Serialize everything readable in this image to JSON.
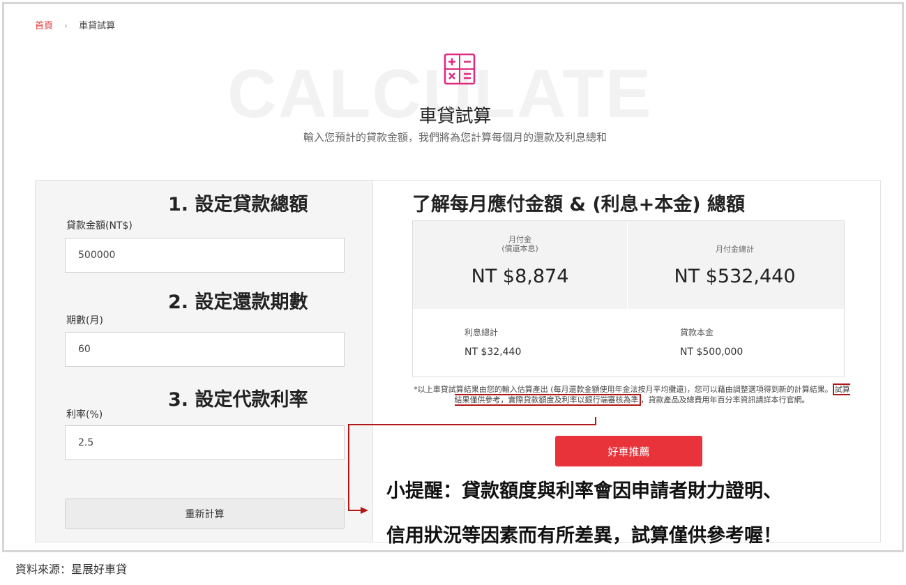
{
  "breadcrumb": {
    "home": "首頁",
    "separator": "›",
    "current": "車貸試算"
  },
  "hero": {
    "bg_word": "CALCULATE",
    "title": "車貸試算",
    "subtitle": "輸入您預計的貸款金額，我們將為您計算每個月的還款及利息總和"
  },
  "steps": {
    "step1": "1. 設定貸款總額",
    "step2": "2. 設定還款期數",
    "step3": "3. 設定代款利率",
    "right_heading": "了解每月應付金額 & (利息+本金) 總額"
  },
  "form": {
    "amount_label": "貸款金額(NT$)",
    "amount_value": "500000",
    "period_label": "期數(月)",
    "period_value": "60",
    "rate_label": "利率(%)",
    "rate_value": "2.5",
    "recalc_label": "重新計算"
  },
  "results": {
    "monthly_label": "月付金",
    "monthly_sub": "(償還本息)",
    "monthly_value": "NT $8,874",
    "total_label": "月付金總計",
    "total_value": "NT $532,440",
    "interest_label": "利息總計",
    "interest_value": "NT $32,440",
    "principal_label": "貸款本金",
    "principal_value": "NT $500,000"
  },
  "note": {
    "part1": "*以上車貸試算結果由您的輸入估算產出 (每月還款金額使用年金法按月平均攤還)，您可以藉由調整選項得到新的計算結果。",
    "highlight": "試算結果僅供參考，實際貸款額度及利率以銀行端審核為準",
    "part2": "，貸款產品及總費用年百分率資訊請詳本行官網。"
  },
  "car_button": "好車推薦",
  "reminder": {
    "line1": "小提醒：貸款額度與利率會因申請者財力證明、",
    "line2": "信用狀況等因素而有所差異，試算僅供參考喔！"
  },
  "source": "資料來源：星展好車貸",
  "colors": {
    "accent_red": "#e8333b",
    "breadcrumb_red": "#e03a3a",
    "icon_pink": "#e0287f",
    "annotation_red": "#b01818"
  },
  "icons": [
    "calculator-icon",
    "chevron-right-icon",
    "arrow-right-icon"
  ]
}
